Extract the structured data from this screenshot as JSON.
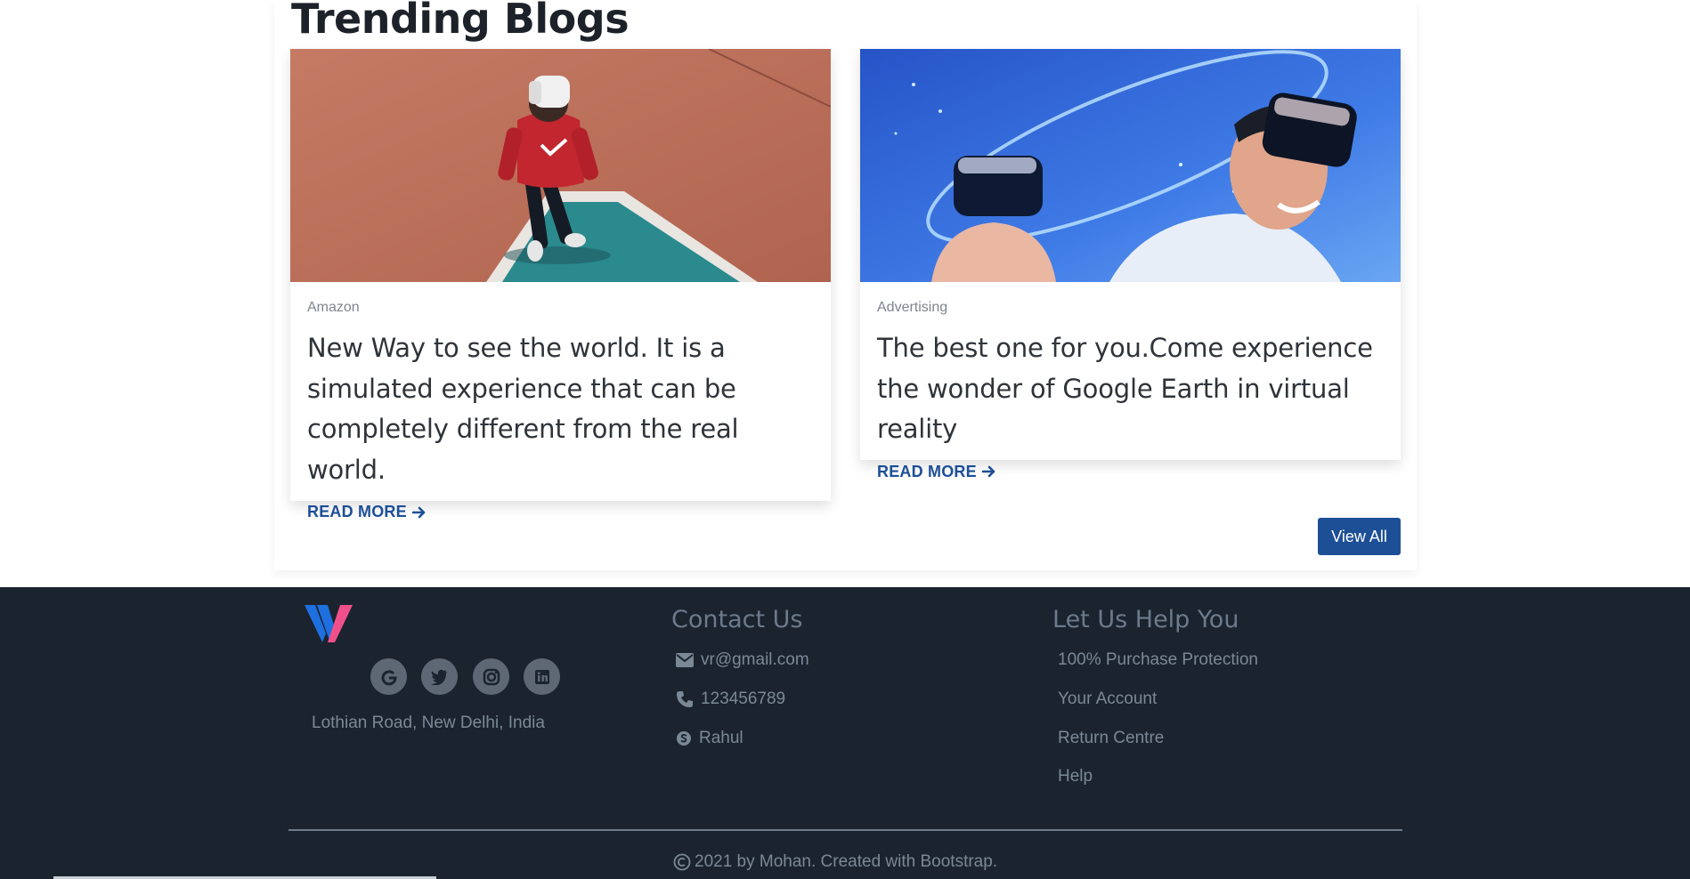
{
  "section": {
    "title": "Trending Blogs"
  },
  "blogs": [
    {
      "category": "Amazon",
      "text": "New Way to see the world. It is a simulated experience that can be completely different from the real world.",
      "read_more": "READ MORE"
    },
    {
      "category": "Advertising",
      "text": "The best one for you.Come experience the wonder of Google Earth in virtual reality",
      "read_more": "READ MORE"
    }
  ],
  "view_all_label": "View All",
  "footer": {
    "social_icons": [
      "google-icon",
      "twitter-icon",
      "instagram-icon",
      "linkedin-icon"
    ],
    "address": "Lothian Road, New Delhi, India",
    "contact": {
      "title": "Contact Us",
      "email": "vr@gmail.com",
      "phone": "123456789",
      "skype": "Rahul"
    },
    "help": {
      "title": "Let Us Help You",
      "links": [
        "100% Purchase Protection",
        "Your Account",
        "Return Centre",
        "Help"
      ]
    },
    "copyright": "2021 by Mohan. Created with Bootstrap."
  },
  "colors": {
    "accent": "#1d4f97",
    "footer_bg": "#1b232e",
    "footer_text": "#7b8896",
    "logo_blue": "#1e6fe0",
    "logo_pink": "#f0508a"
  }
}
